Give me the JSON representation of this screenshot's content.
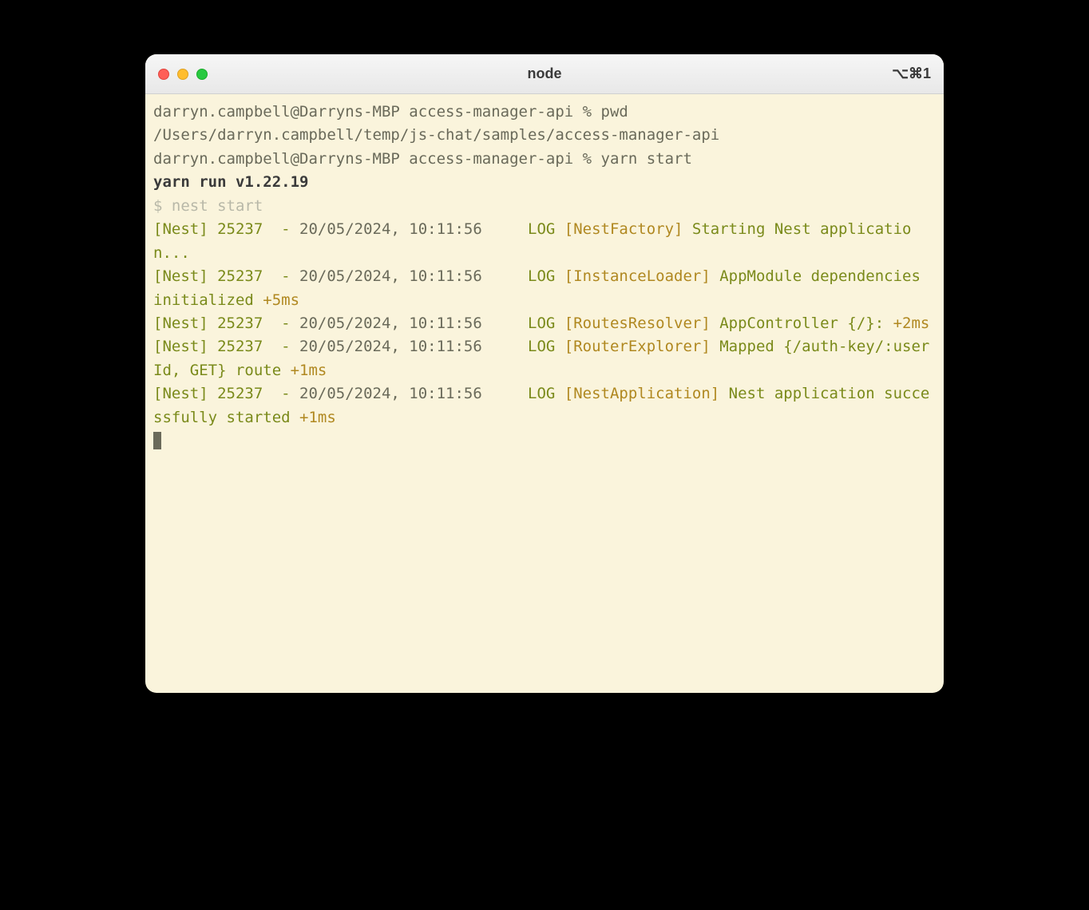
{
  "window": {
    "title": "node",
    "shortcut": "⌥⌘1"
  },
  "terminal": {
    "line1_prompt": "darryn.campbell@Darryns-MBP access-manager-api % ",
    "line1_cmd": "pwd",
    "line2": "/Users/darryn.campbell/temp/js-chat/samples/access-manager-api",
    "line3_prompt": "darryn.campbell@Darryns-MBP access-manager-api % ",
    "line3_cmd": "yarn start",
    "line4": "yarn run v1.22.19",
    "line5_prefix": "$ ",
    "line5_cmd": "nest start",
    "log1": {
      "nest": "[Nest] 25237  - ",
      "date": "20/05/2024, 10:11:56 ",
      "log": "    LOG ",
      "context": "[NestFactory] ",
      "msg": "Starting Nest application..."
    },
    "log2": {
      "nest": "[Nest] 25237  - ",
      "date": "20/05/2024, 10:11:56 ",
      "log": "    LOG ",
      "context": "[InstanceLoader] ",
      "msg": "AppModule dependencies initialized ",
      "time": "+5ms"
    },
    "log3": {
      "nest": "[Nest] 25237  - ",
      "date": "20/05/2024, 10:11:56 ",
      "log": "    LOG ",
      "context": "[RoutesResolver] ",
      "msg": "AppController {/}: ",
      "time": "+2ms"
    },
    "log4": {
      "nest": "[Nest] 25237  - ",
      "date": "20/05/2024, 10:11:56 ",
      "log": "    LOG ",
      "context": "[RouterExplorer] ",
      "msg": "Mapped {/auth-key/:userId, GET} route ",
      "time": "+1ms"
    },
    "log5": {
      "nest": "[Nest] 25237  - ",
      "date": "20/05/2024, 10:11:56 ",
      "log": "    LOG ",
      "context": "[NestApplication] ",
      "msg": "Nest application successfully started ",
      "time": "+1ms"
    }
  }
}
